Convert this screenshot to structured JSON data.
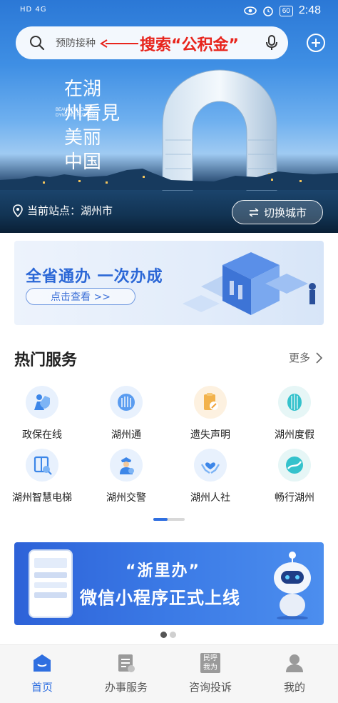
{
  "status_bar": {
    "signal": "HD 4G",
    "battery": "60",
    "time": "2:48"
  },
  "search": {
    "placeholder": "预防接种",
    "annotation": "搜索“公积金”"
  },
  "hero": {
    "calligraphy": [
      "在",
      "湖",
      "州",
      "看",
      "見",
      "美",
      "丽",
      "中",
      "国"
    ],
    "subtitle_en": "BEAUTIFUL CHINA DYNAMIC HUZHOU",
    "station_label": "当前站点：湖州市",
    "switch_city": "切换城市"
  },
  "banner_top": {
    "title": "全省通办  一次办成",
    "button": "点击查看 >>"
  },
  "hot_services": {
    "title": "热门服务",
    "more": "更多",
    "items": [
      {
        "label": "政保在线",
        "icon": "person-shield-icon",
        "bg": "#e8f1fd",
        "color": "#3c86e8"
      },
      {
        "label": "湖州通",
        "icon": "city-logo-icon",
        "bg": "#e8f1fd",
        "color": "#3c86e8"
      },
      {
        "label": "遗失声明",
        "icon": "document-seal-icon",
        "bg": "#fdf1e0",
        "color": "#f0a23a"
      },
      {
        "label": "湖州度假",
        "icon": "lantern-icon",
        "bg": "#e6f6f6",
        "color": "#2ab6c0"
      },
      {
        "label": "湖州智慧电梯",
        "icon": "elevator-icon",
        "bg": "#e8f1fd",
        "color": "#3c86e8"
      },
      {
        "label": "湖州交警",
        "icon": "police-officer-icon",
        "bg": "#e8f1fd",
        "color": "#3c86e8"
      },
      {
        "label": "湖州人社",
        "icon": "hands-heart-icon",
        "bg": "#e8f1fd",
        "color": "#3c86e8"
      },
      {
        "label": "畅行湖州",
        "icon": "road-icon",
        "bg": "#e6f6f6",
        "color": "#2ab6c0"
      }
    ]
  },
  "banner_bottom": {
    "line1": "“浙里办”",
    "line2": "微信小程序正式上线"
  },
  "tabbar": {
    "items": [
      {
        "label": "首页",
        "icon": "home-icon",
        "active": true
      },
      {
        "label": "办事服务",
        "icon": "service-list-icon",
        "active": false
      },
      {
        "label": "咨询投诉",
        "icon": "complaint-icon",
        "active": false,
        "badge": [
          "民呼",
          "我为"
        ]
      },
      {
        "label": "我的",
        "icon": "user-icon",
        "active": false
      }
    ]
  },
  "colors": {
    "accent": "#2f6fe0",
    "annotation_red": "#e8251d"
  }
}
